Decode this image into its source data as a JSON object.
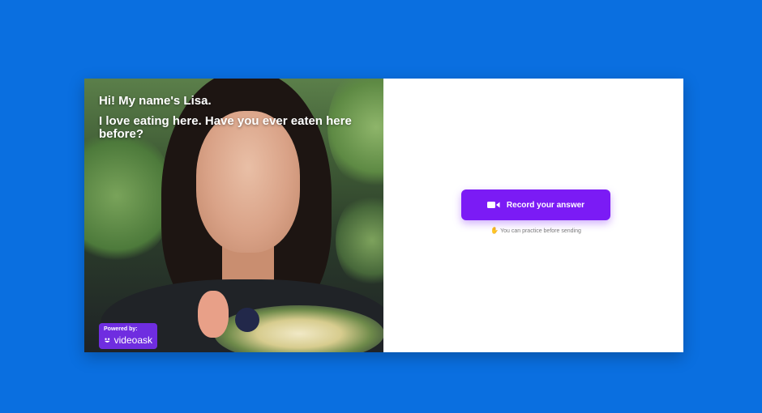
{
  "page": {
    "background_color": "#0a6fe0"
  },
  "video": {
    "greeting": "Hi! My name's Lisa.",
    "question": "I love eating here. Have you ever eaten here before?"
  },
  "branding": {
    "powered_by": "Powered by:",
    "name": "videoask",
    "icon": "smile-icon",
    "color": "#6f2de0"
  },
  "answer": {
    "record_button_label": "Record your answer",
    "record_icon": "video-camera-icon",
    "record_button_color": "#7b1bf5",
    "practice_hint": "You can practice before sending",
    "practice_icon": "hand-wave-icon"
  }
}
